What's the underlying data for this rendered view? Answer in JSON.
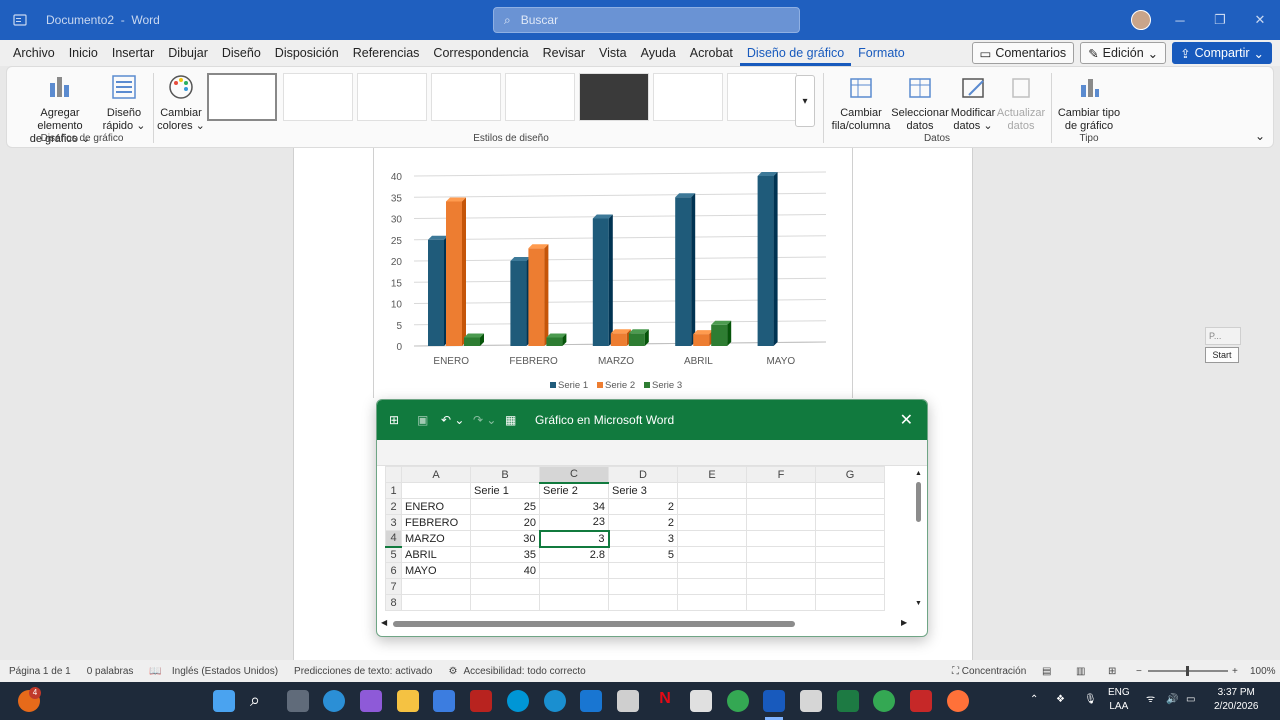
{
  "app": {
    "doc_title": "Documento2",
    "app_name": "Word",
    "search_placeholder": "Buscar"
  },
  "window_controls": {
    "minimize": "─",
    "restore": "❐",
    "close": "✕"
  },
  "menu": {
    "tabs": [
      "Archivo",
      "Inicio",
      "Insertar",
      "Dibujar",
      "Diseño",
      "Disposición",
      "Referencias",
      "Correspondencia",
      "Revisar",
      "Vista",
      "Ayuda",
      "Acrobat",
      "Diseño de gráfico",
      "Formato"
    ],
    "comments_label": "Comentarios",
    "edit_label": "Edición",
    "share_label": "Compartir"
  },
  "ribbon": {
    "add_element": [
      "Agregar elemento",
      "de gráfico"
    ],
    "quick_layout": [
      "Diseño",
      "rápido"
    ],
    "change_colors": [
      "Cambiar",
      "colores"
    ],
    "group_chart_designs": "Diseños de gráfico",
    "group_styles": "Estilos de diseño",
    "switch_row_col": [
      "Cambiar",
      "fila/columna"
    ],
    "select_data": [
      "Seleccionar",
      "datos"
    ],
    "edit_data": [
      "Modificar",
      "datos"
    ],
    "refresh_data": [
      "Actualizar",
      "datos"
    ],
    "group_data": "Datos",
    "change_type": [
      "Cambiar tipo",
      "de gráfico"
    ],
    "group_type": "Tipo"
  },
  "chart_data": {
    "type": "bar",
    "categories": [
      "ENERO",
      "FEBRERO",
      "MARZO",
      "ABRIL",
      "MAYO"
    ],
    "series": [
      {
        "name": "Serie 1",
        "values": [
          25,
          20,
          30,
          35,
          40
        ],
        "color": "#1f5b7a"
      },
      {
        "name": "Serie 2",
        "values": [
          34,
          23,
          3,
          2.8,
          0
        ],
        "color": "#ed7d31"
      },
      {
        "name": "Serie 3",
        "values": [
          2,
          2,
          3,
          5,
          0
        ],
        "color": "#2e7d32"
      }
    ],
    "yticks": [
      "0",
      "5",
      "10",
      "15",
      "20",
      "25",
      "30",
      "35",
      "40"
    ],
    "ylim": [
      0,
      40
    ],
    "legend_position": "bottom",
    "grid": true
  },
  "start_widget": {
    "p_label": "P...",
    "start_label": "Start"
  },
  "excel": {
    "title": "Gráfico en Microsoft Word",
    "columns": [
      "A",
      "B",
      "C",
      "D",
      "E",
      "F",
      "G"
    ],
    "rows": [
      [
        "",
        "Serie 1",
        "Serie 2",
        "Serie 3",
        "",
        "",
        ""
      ],
      [
        "ENERO",
        "25",
        "34",
        "2",
        "",
        "",
        ""
      ],
      [
        "FEBRERO",
        "20",
        "23",
        "2",
        "",
        "",
        ""
      ],
      [
        "MARZO",
        "30",
        "3",
        "3",
        "",
        "",
        ""
      ],
      [
        "ABRIL",
        "35",
        "2.8",
        "5",
        "",
        "",
        ""
      ],
      [
        "MAYO",
        "40",
        "",
        "",
        "",
        "",
        ""
      ],
      [
        "",
        "",
        "",
        "",
        "",
        "",
        ""
      ],
      [
        "",
        "",
        "",
        "",
        "",
        "",
        ""
      ]
    ],
    "row_numbers": [
      "1",
      "2",
      "3",
      "4",
      "5",
      "6",
      "7",
      "8"
    ]
  },
  "status": {
    "page": "Página 1 de 1",
    "words": "0 palabras",
    "language": "Inglés (Estados Unidos)",
    "predictions": "Predicciones de texto: activado",
    "accessibility": "Accesibilidad: todo correcto",
    "focus": "Concentración",
    "zoom": "100%"
  },
  "taskbar": {
    "lang": [
      "ENG",
      "LAA"
    ],
    "time": "3:37 PM",
    "date": "2/20/2026",
    "badge": "4"
  }
}
